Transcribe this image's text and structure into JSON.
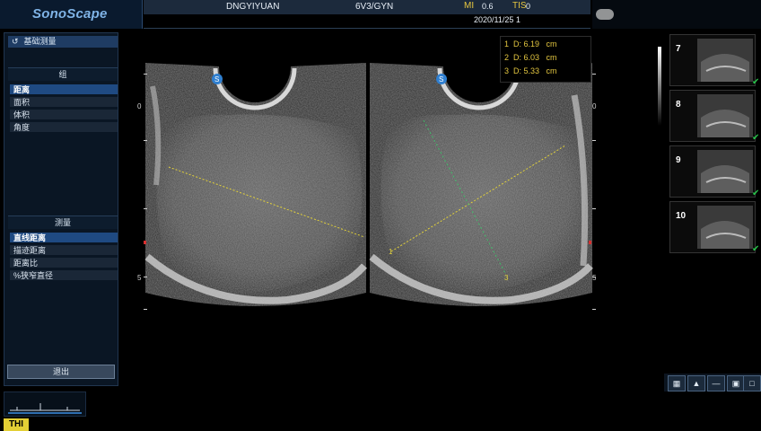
{
  "header": {
    "brand": "SonoScape",
    "hospital": "DNGYIYUAN",
    "probe_preset": "6V3/GYN",
    "mi_label": "MI",
    "mi_value": "0.6",
    "tis_label": "TIS",
    "tis_value": "0",
    "datetime": "2020/11/25 1"
  },
  "left_panel": {
    "back_label": "基础测量",
    "group_title": "组",
    "group_items": [
      {
        "label": "距离",
        "selected": true
      },
      {
        "label": "面积",
        "selected": false
      },
      {
        "label": "体积",
        "selected": false
      },
      {
        "label": "角度",
        "selected": false
      }
    ],
    "measure_title": "测量",
    "measure_items": [
      {
        "label": "直线距离",
        "selected": true
      },
      {
        "label": "描迹距离",
        "selected": false
      },
      {
        "label": "距离比",
        "selected": false
      },
      {
        "label": "%狭窄直径",
        "selected": false
      }
    ],
    "exit_label": "退出"
  },
  "measurements": [
    "1  D: 6.19   cm",
    "2  D: 6.03   cm",
    "3  D: 5.33   cm"
  ],
  "scale": {
    "left_top": "0",
    "left_bottom": "5",
    "right_top": "0",
    "right_bottom": "5",
    "point_1": "1",
    "point_3": "3"
  },
  "thumbnails": [
    {
      "num": "7",
      "checked": true
    },
    {
      "num": "8",
      "checked": true
    },
    {
      "num": "9",
      "checked": true
    },
    {
      "num": "10",
      "checked": true
    }
  ],
  "footer": {
    "mode": "THI"
  },
  "colors": {
    "accent_blue": "#1f4a82",
    "measure_yellow": "#e3c640",
    "check_green": "#28c24a"
  }
}
